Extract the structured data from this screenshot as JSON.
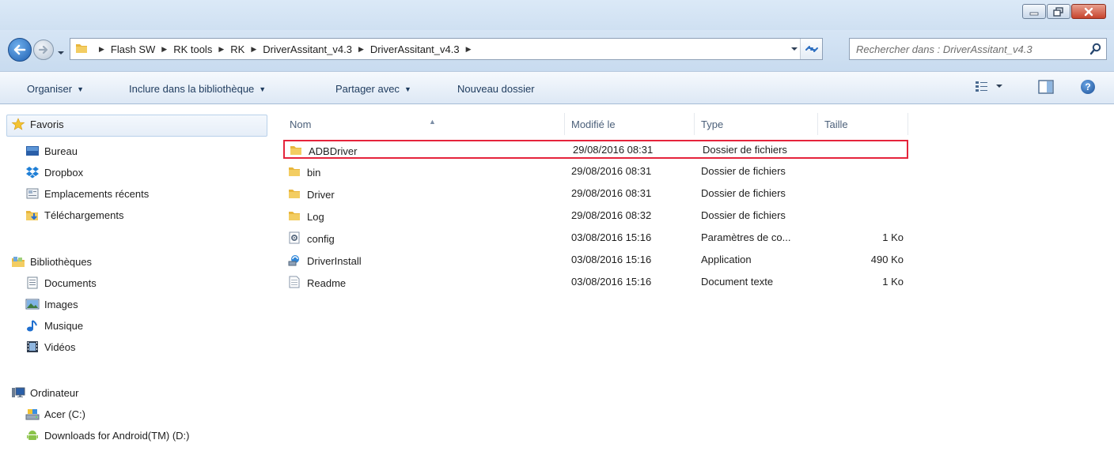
{
  "window": {
    "controls": [
      "minimize-icon",
      "maximize-icon",
      "close-icon"
    ]
  },
  "address": {
    "breadcrumbs": [
      "Flash SW",
      "RK tools",
      "RK",
      "DriverAssitant_v4.3",
      "DriverAssitant_v4.3"
    ],
    "search_placeholder": "Rechercher dans : DriverAssitant_v4.3"
  },
  "toolbar": {
    "organize": "Organiser",
    "include_library": "Inclure dans la bibliothèque",
    "share_with": "Partager avec",
    "new_folder": "Nouveau dossier",
    "help": "?"
  },
  "navigation": {
    "favorites": {
      "label": "Favoris",
      "items": [
        "Bureau",
        "Dropbox",
        "Emplacements récents",
        "Téléchargements"
      ]
    },
    "libraries": {
      "label": "Bibliothèques",
      "items": [
        "Documents",
        "Images",
        "Musique",
        "Vidéos"
      ]
    },
    "computer": {
      "label": "Ordinateur",
      "items": [
        "Acer (C:)",
        "Downloads for Android(TM) (D:)"
      ]
    }
  },
  "files": {
    "columns": [
      "Nom",
      "Modifié le",
      "Type",
      "Taille"
    ],
    "rows": [
      {
        "name": "ADBDriver",
        "modified": "29/08/2016 08:31",
        "type": "Dossier de fichiers",
        "size": "",
        "icon": "folder-icon",
        "selected": true
      },
      {
        "name": "bin",
        "modified": "29/08/2016 08:31",
        "type": "Dossier de fichiers",
        "size": "",
        "icon": "folder-icon"
      },
      {
        "name": "Driver",
        "modified": "29/08/2016 08:31",
        "type": "Dossier de fichiers",
        "size": "",
        "icon": "folder-icon"
      },
      {
        "name": "Log",
        "modified": "29/08/2016 08:32",
        "type": "Dossier de fichiers",
        "size": "",
        "icon": "folder-icon"
      },
      {
        "name": "config",
        "modified": "03/08/2016 15:16",
        "type": "Paramètres de co...",
        "size": "1 Ko",
        "icon": "settings-file-icon"
      },
      {
        "name": "DriverInstall",
        "modified": "03/08/2016 15:16",
        "type": "Application",
        "size": "490 Ko",
        "icon": "application-icon"
      },
      {
        "name": "Readme",
        "modified": "03/08/2016 15:16",
        "type": "Document texte",
        "size": "1 Ko",
        "icon": "text-file-icon"
      }
    ]
  },
  "colors": {
    "selection_border": "#e5243b",
    "toolbar_text": "#1e3b5e",
    "folder": "#e8b63d"
  }
}
